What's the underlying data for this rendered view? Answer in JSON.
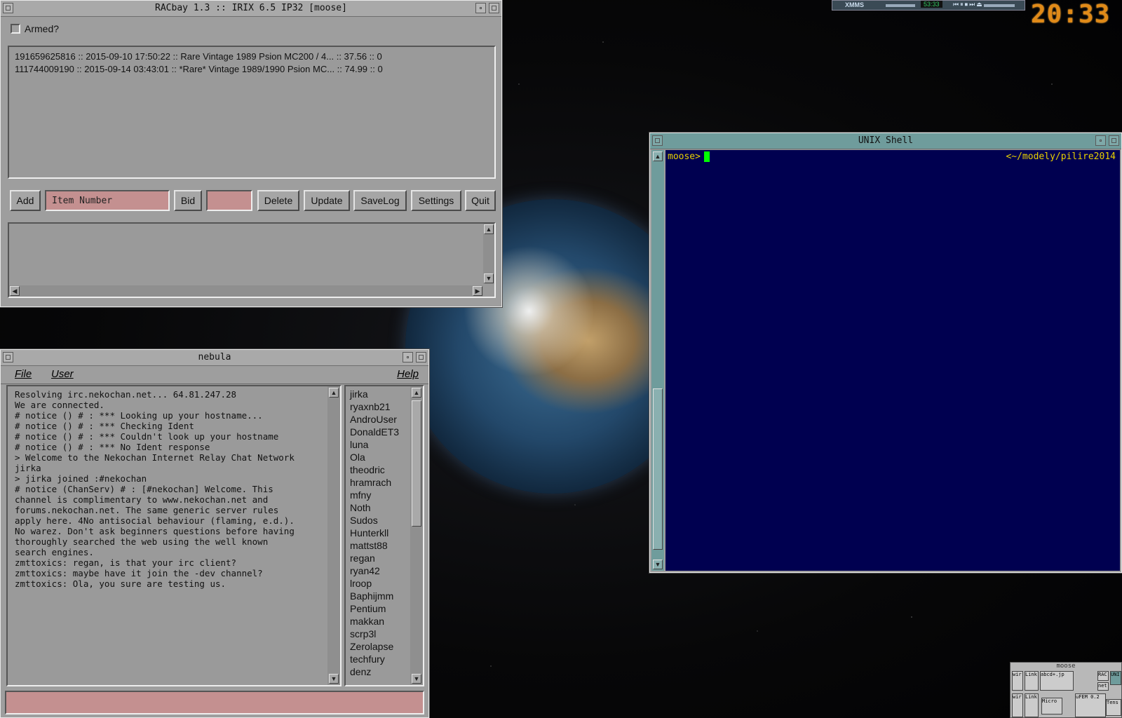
{
  "racbay": {
    "title": "RACbay 1.3 :: IRIX 6.5 IP32 [moose]",
    "armed_label": "Armed?",
    "items": [
      "191659625816 :: 2015-09-10 17:50:22 :: Rare Vintage 1989 Psion MC200 / 4... :: 37.56 :: 0",
      "111744009190 :: 2015-09-14 03:43:01 :: *Rare* Vintage 1989/1990 Psion MC... :: 74.99 :: 0"
    ],
    "buttons": {
      "add": "Add",
      "bid": "Bid",
      "delete": "Delete",
      "update": "Update",
      "savelog": "SaveLog",
      "settings": "Settings",
      "quit": "Quit"
    },
    "item_number_value": "Item Number"
  },
  "nebula": {
    "title": "nebula",
    "menu": {
      "file": "File",
      "user": "User",
      "help": "Help"
    },
    "log": [
      "Resolving irc.nekochan.net... 64.81.247.28",
      "We are connected.",
      "# notice () # : *** Looking up your hostname...",
      "# notice () # : *** Checking Ident",
      "# notice () # : *** Couldn't look up your hostname",
      "# notice () # : *** No Ident response",
      "> Welcome to the Nekochan Internet Relay Chat Network",
      "jirka",
      "> jirka joined :#nekochan",
      "# notice (ChanServ) # : [#nekochan] Welcome. This",
      "channel is complimentary to www.nekochan.net and",
      "forums.nekochan.net. The same generic server rules",
      "apply here. 4No antisocial behaviour (flaming, e.d.).",
      "No warez. Don't ask beginners questions before having",
      "thoroughly searched the web using the well known",
      "search engines.",
      "zmttoxics: regan, is that your irc client?",
      "zmttoxics: maybe have it join the -dev channel?",
      "zmttoxics: Ola, you sure are testing us."
    ],
    "users": [
      "jirka",
      "ryaxnb21",
      "AndroUser",
      "DonaldET3",
      "luna",
      "Ola",
      "theodric",
      "hramrach",
      "mfny",
      "Noth",
      "Sudos",
      "Hunterkll",
      "mattst88",
      "regan",
      "ryan42",
      "lroop",
      "Baphijmm",
      "Pentium",
      "makkan",
      "scrp3l",
      "Zerolapse",
      "techfury",
      "denz"
    ]
  },
  "shell": {
    "title": "UNIX Shell",
    "prompt": "moose>",
    "path": "<~/modely/pilire2014"
  },
  "xmms": {
    "label": "XMMS",
    "time": "53:33"
  },
  "clock": "20:33",
  "pager": {
    "label": "moose",
    "cells": [
      "wir",
      "Link",
      "abcd+.jp",
      "RAC",
      "UNI",
      "net",
      "wir",
      "Link",
      "Micro",
      "uFEM 0.2",
      "Tens"
    ]
  },
  "colors": {
    "terminal_bg": "#000050",
    "terminal_prompt": "#e8d000",
    "terminal_cursor": "#00ff00",
    "field_pink": "#c49090",
    "window_gray": "#9e9e9e",
    "title_teal": "#6f9c9c",
    "clock_orange": "#e08a18"
  }
}
